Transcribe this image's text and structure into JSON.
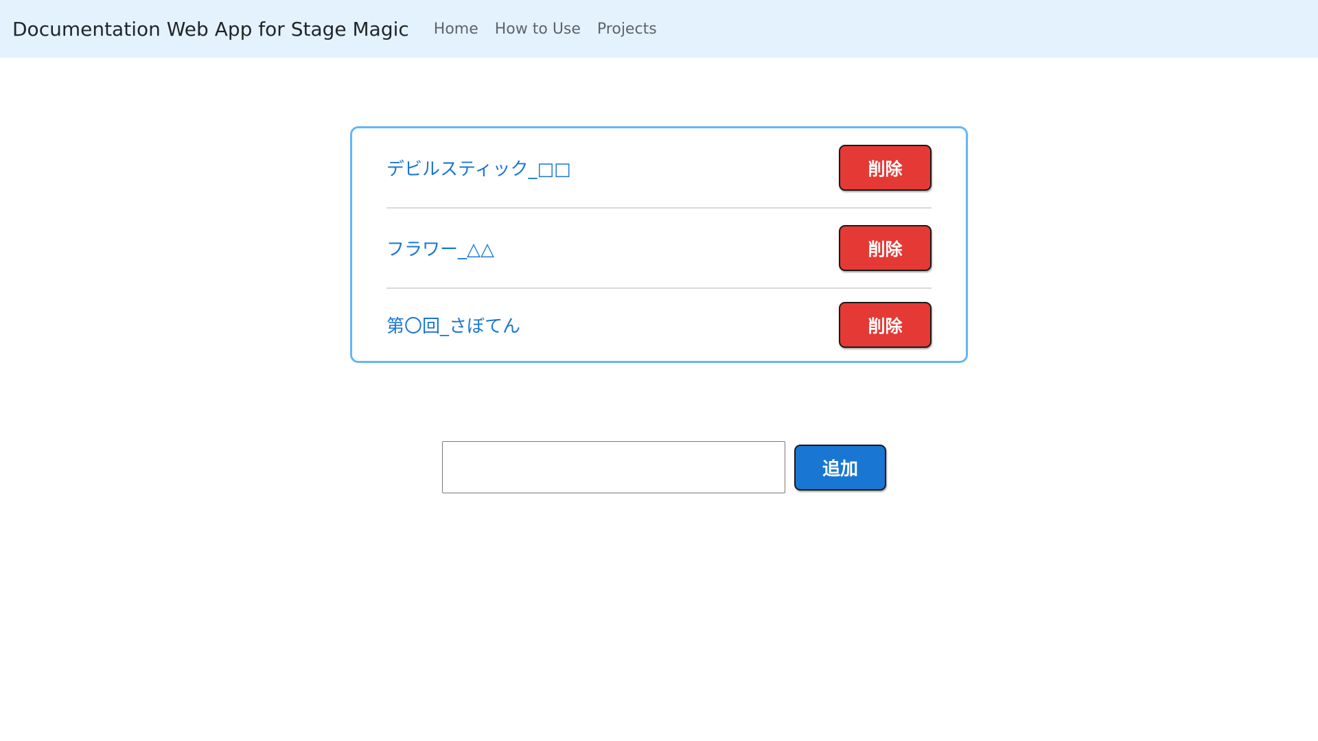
{
  "navbar": {
    "brand": "Documentation Web App for Stage Magic",
    "links": [
      {
        "label": "Home"
      },
      {
        "label": "How to Use"
      },
      {
        "label": "Projects"
      }
    ]
  },
  "projects": {
    "items": [
      {
        "name": "デビルスティック_□□",
        "delete_label": "削除"
      },
      {
        "name": "フラワー_△△",
        "delete_label": "削除"
      },
      {
        "name": "第〇回_さぼてん",
        "delete_label": "削除"
      }
    ]
  },
  "add_form": {
    "input_value": "",
    "input_placeholder": "",
    "button_label": "追加"
  },
  "colors": {
    "navbar_bg": "#e3f2fd",
    "card_border": "#64b5f6",
    "link": "#1976d2",
    "delete_button": "#e53935",
    "add_button": "#1976d2"
  }
}
